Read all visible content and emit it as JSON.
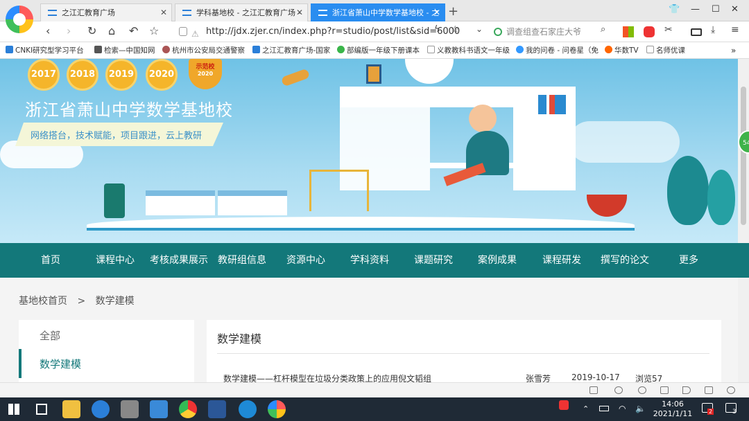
{
  "browser": {
    "tabs": [
      {
        "label": "之江汇教育广场"
      },
      {
        "label": "学科基地校 - 之江汇教育广场 -"
      },
      {
        "label": "浙江省萧山中学数学基地校 - 之"
      }
    ],
    "url": "http://jdx.zjer.cn/index.php?r=studio/post/list&sid=6000",
    "search_placeholder": "调查组查石家庄大爷",
    "bookmarks": [
      "CNKI研究型学习平台",
      "检索—中国知网",
      "杭州市公安局交通警察",
      "之江汇教育广场-国家",
      "部编版一年级下册课本",
      "义教教科书语文一年级",
      "我的问卷 - 问卷星（免",
      "华数TV",
      "名师优课"
    ]
  },
  "banner": {
    "years": [
      "2017",
      "2018",
      "2019",
      "2020"
    ],
    "badge_text": "示范校",
    "badge_year": "2020",
    "school_name": "浙江省萧山中学数学基地校",
    "slogan": "网络搭台，技术赋能，项目跟进，云上教研"
  },
  "menu": [
    "首页",
    "课程中心",
    "考核成果展示",
    "教研组信息",
    "资源中心",
    "学科资料",
    "课题研究",
    "案例成果",
    "课程研发",
    "撰写的论文",
    "更多"
  ],
  "breadcrumb": {
    "home": "基地校首页",
    "sep": ">",
    "current": "数学建模"
  },
  "sidebar": {
    "all": "全部",
    "active": "数学建模"
  },
  "main": {
    "title": "数学建模",
    "posts": [
      {
        "title": "数学建模——杠杆模型在垃圾分类政策上的应用倪文韬组",
        "author": "张雪芳",
        "date": "2019-10-17",
        "views": "浏览57"
      }
    ]
  },
  "scroll_badge": "54",
  "taskbar": {
    "time": "14:06",
    "date": "2021/1/11",
    "notif": "3",
    "mail": "2"
  },
  "colors": {
    "menu_bg": "#13787a",
    "tab_active": "#2a8df0"
  }
}
